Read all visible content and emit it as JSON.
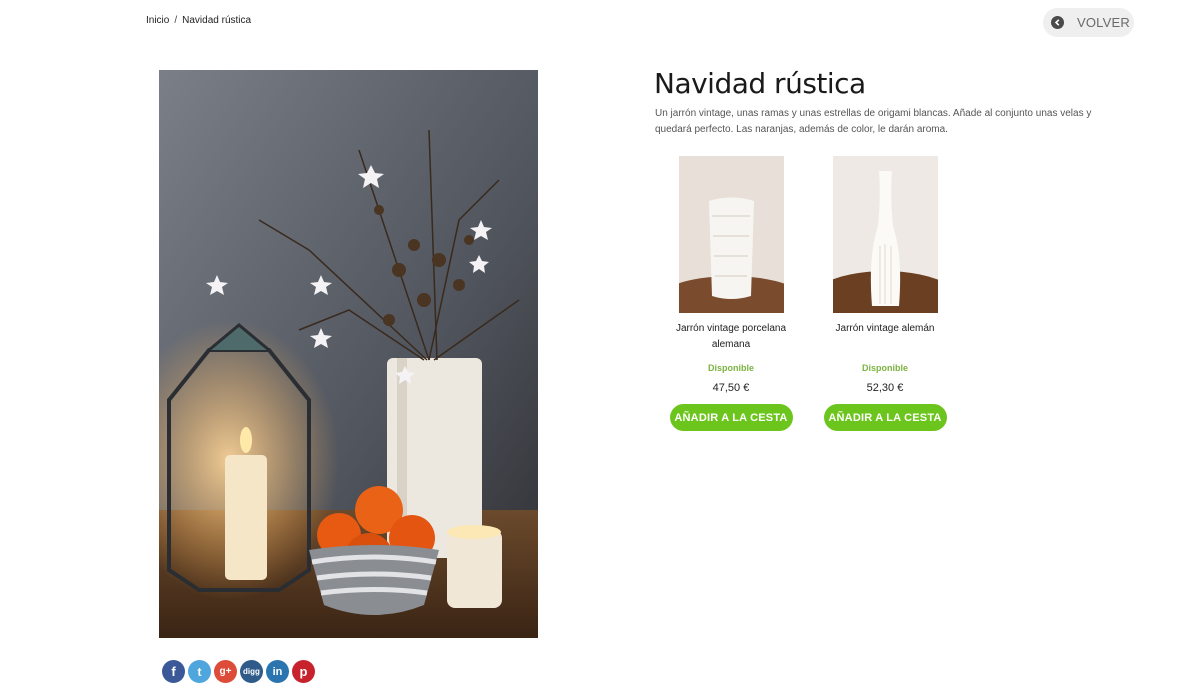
{
  "breadcrumb": {
    "home": "Inicio",
    "separator": "/",
    "current": "Navidad rústica"
  },
  "back_button": {
    "label": "VOLVER",
    "icon": "chevron-left-icon"
  },
  "article": {
    "title": "Navidad rústica",
    "description": "Un jarrón vintage, unas ramas y unas estrellas de origami blancas. Añade al conjunto unas velas y quedará perfecto. Las naranjas, además de color, le darán aroma."
  },
  "products": [
    {
      "name": "Jarrón vintage porcelana alemana",
      "availability": "Disponible",
      "price": "47,50 €",
      "cta": "AÑADIR A LA CESTA"
    },
    {
      "name": "Jarrón vintage alemán",
      "availability": "Disponible",
      "price": "52,30 €",
      "cta": "AÑADIR A LA CESTA"
    }
  ],
  "share": {
    "facebook": "f",
    "twitter": "t",
    "googleplus": "g+",
    "digg": "digg",
    "linkedin": "in",
    "pinterest": "p"
  },
  "colors": {
    "accent_green": "#6cc51c",
    "available_green": "#7cb342",
    "facebook": "#3b5998",
    "twitter": "#4ea6dd",
    "googleplus": "#dd4b39",
    "digg": "#2f5b8a",
    "linkedin": "#2a75b0",
    "pinterest": "#c8232c"
  }
}
